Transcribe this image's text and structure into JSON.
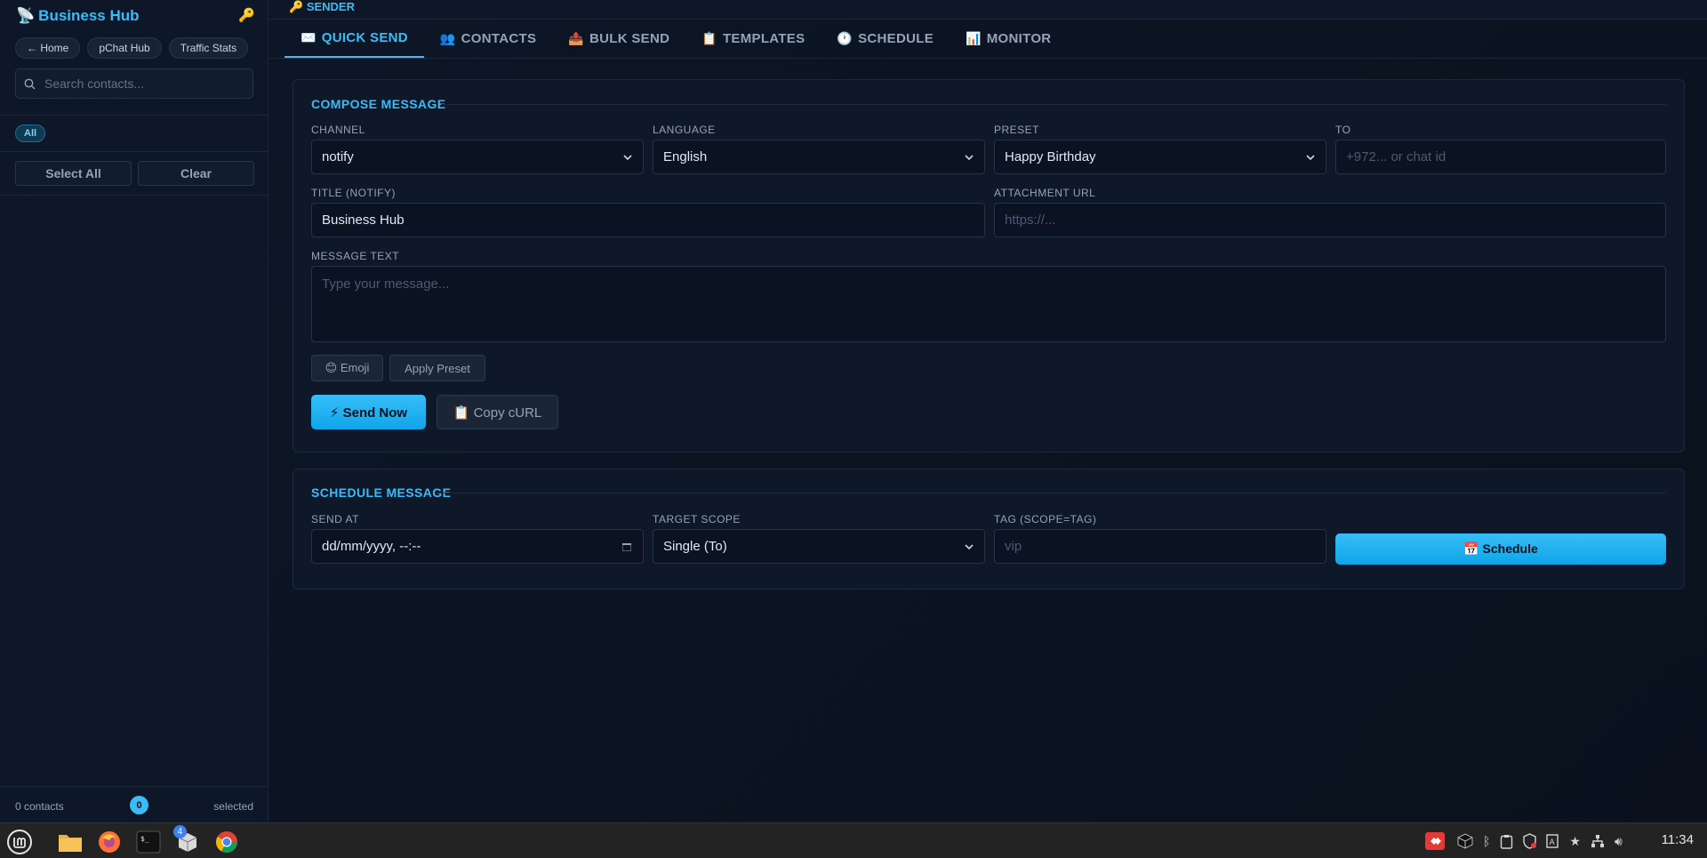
{
  "sidebar": {
    "brand": "Business Hub",
    "nav": [
      "← Home",
      "pChat Hub",
      "Traffic Stats"
    ],
    "search_placeholder": "Search contacts...",
    "tag_all": "All",
    "select_all": "Select All",
    "clear": "Clear",
    "footer": {
      "count": "0 contacts",
      "badge": "0",
      "selected": "selected"
    }
  },
  "header": {
    "sender": "SENDER"
  },
  "tabs": [
    {
      "icon": "✉️",
      "label": "QUICK SEND"
    },
    {
      "icon": "👥",
      "label": "CONTACTS"
    },
    {
      "icon": "📤",
      "label": "BULK SEND"
    },
    {
      "icon": "📋",
      "label": "TEMPLATES"
    },
    {
      "icon": "🕐",
      "label": "SCHEDULE"
    },
    {
      "icon": "📊",
      "label": "MONITOR"
    }
  ],
  "compose": {
    "title": "COMPOSE MESSAGE",
    "channel": {
      "label": "CHANNEL",
      "value": "notify"
    },
    "language": {
      "label": "LANGUAGE",
      "value": "English"
    },
    "preset": {
      "label": "PRESET",
      "value": "Happy Birthday"
    },
    "to": {
      "label": "TO",
      "placeholder": "+972... or chat id"
    },
    "title_notify": {
      "label": "TITLE (NOTIFY)",
      "value": "Business Hub"
    },
    "attachment": {
      "label": "ATTACHMENT URL",
      "placeholder": "https://..."
    },
    "message": {
      "label": "MESSAGE TEXT",
      "placeholder": "Type your message..."
    },
    "emoji_btn": "😊 Emoji",
    "apply_preset_btn": "Apply Preset",
    "send_now_btn": "⚡ Send Now",
    "copy_curl_btn": "📋 Copy cURL"
  },
  "schedule": {
    "title": "SCHEDULE MESSAGE",
    "send_at": {
      "label": "SEND AT",
      "value": "dd/mm/yyyy, --:--"
    },
    "target_scope": {
      "label": "TARGET SCOPE",
      "value": "Single (To)"
    },
    "tag": {
      "label": "TAG (SCOPE=TAG)",
      "placeholder": "vip"
    },
    "schedule_btn": "📅 Schedule"
  },
  "taskbar": {
    "clock": "11:34",
    "badge": "4"
  },
  "colors": {
    "accent": "#38bdf8",
    "background": "#0b1220",
    "panel": "#0e1829"
  }
}
